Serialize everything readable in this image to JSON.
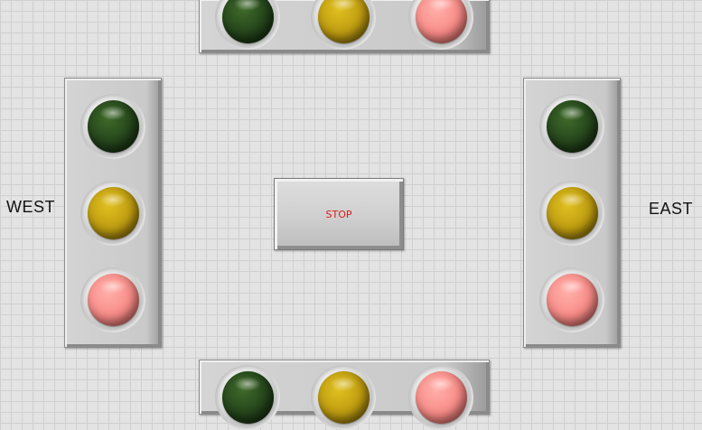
{
  "labels": {
    "west": "WEST",
    "east": "EAST"
  },
  "stop_button": {
    "label": "STOP"
  },
  "lights": {
    "north": [
      "green",
      "yellow",
      "red"
    ],
    "west": [
      "green",
      "yellow",
      "red"
    ],
    "east": [
      "green",
      "yellow",
      "red"
    ],
    "south": [
      "green",
      "yellow",
      "red"
    ]
  },
  "colors": {
    "green_lamp": "#23431a",
    "yellow_lamp": "#bc9a10",
    "red_lamp": "#f88a86",
    "stop_text": "#e01818"
  }
}
